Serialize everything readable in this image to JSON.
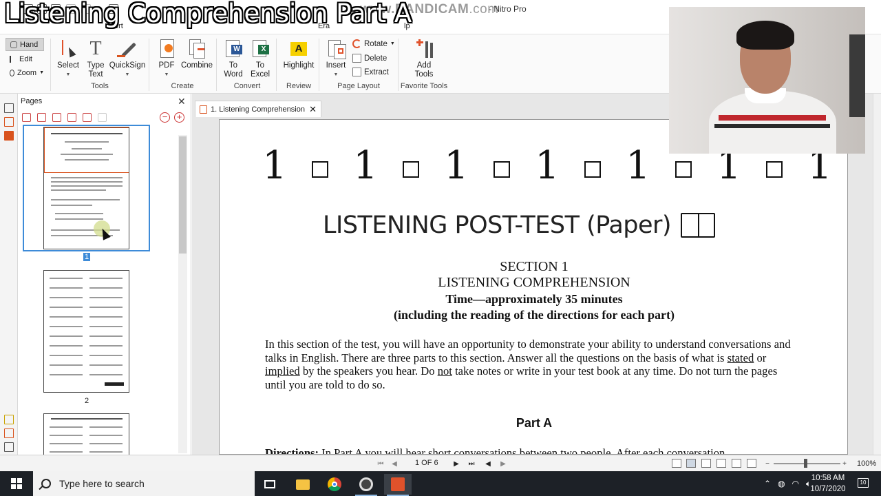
{
  "video_caption": "Listening Comprehension Part A",
  "watermark": {
    "left": "www.",
    "brand": "BANDICAM",
    "right": ".com"
  },
  "app_title": "- Nitro Pro",
  "menu_fragments": [
    "ert",
    "Era",
    "lp"
  ],
  "mode_tools": [
    {
      "label": "Hand"
    },
    {
      "label": "Edit"
    },
    {
      "label": "Zoom"
    }
  ],
  "ribbon": {
    "tools": {
      "label": "Tools",
      "buttons": [
        "Select",
        "Type Text",
        "QuickSign"
      ]
    },
    "create": {
      "label": "Create",
      "buttons": [
        "PDF",
        "Combine"
      ]
    },
    "convert": {
      "label": "Convert",
      "buttons": [
        "To Word",
        "To Excel"
      ]
    },
    "review": {
      "label": "Review",
      "buttons": [
        "Highlight"
      ]
    },
    "page_layout": {
      "label": "Page Layout",
      "buttons": [
        "Insert"
      ],
      "small_buttons": [
        "Rotate",
        "Delete",
        "Extract"
      ]
    },
    "favorite_tools": {
      "label": "Favorite Tools",
      "buttons": [
        "Add Tools"
      ]
    }
  },
  "pages_panel": {
    "title": "Pages",
    "page_numbers": [
      "1",
      "2"
    ]
  },
  "doc_tab": {
    "label": "1. Listening Comprehension"
  },
  "document": {
    "box_row_digit": "1",
    "post_test_title": "LISTENING POST-TEST (Paper)",
    "section": "SECTION 1",
    "section_title": "LISTENING COMPREHENSION",
    "time": "Time—approximately 35 minutes",
    "including": "(including the reading of the directions for each part)",
    "para_1": "In this section of the test, you will have an opportunity to demonstrate your ability to understand conversations and talks in English. There are three parts to this section. Answer all the questions on the basis of what is ",
    "para_stated": "stated",
    "para_or": " or ",
    "para_implied": "implied",
    "para_2": " by the speakers you hear. Do ",
    "para_not": "not",
    "para_3": " take notes or write in your test book at any time. Do not turn the pages until you are told to do so.",
    "part_a": "Part A",
    "directions_label": "Directions:",
    "directions_text": " In Part A you will hear short conversations between two people. After each conversation,"
  },
  "statusbar": {
    "page_indicator": "1 OF 6",
    "zoom": "100%",
    "zoom_fraction": 0.47
  },
  "taskbar": {
    "search_placeholder": "Type here to search",
    "time": "10:58 AM",
    "date": "10/7/2020",
    "notifications": "10"
  },
  "colors": {
    "accent_blue": "#3d8bd8",
    "nitro_red": "#d9531e",
    "taskbar": "#1d2127"
  }
}
